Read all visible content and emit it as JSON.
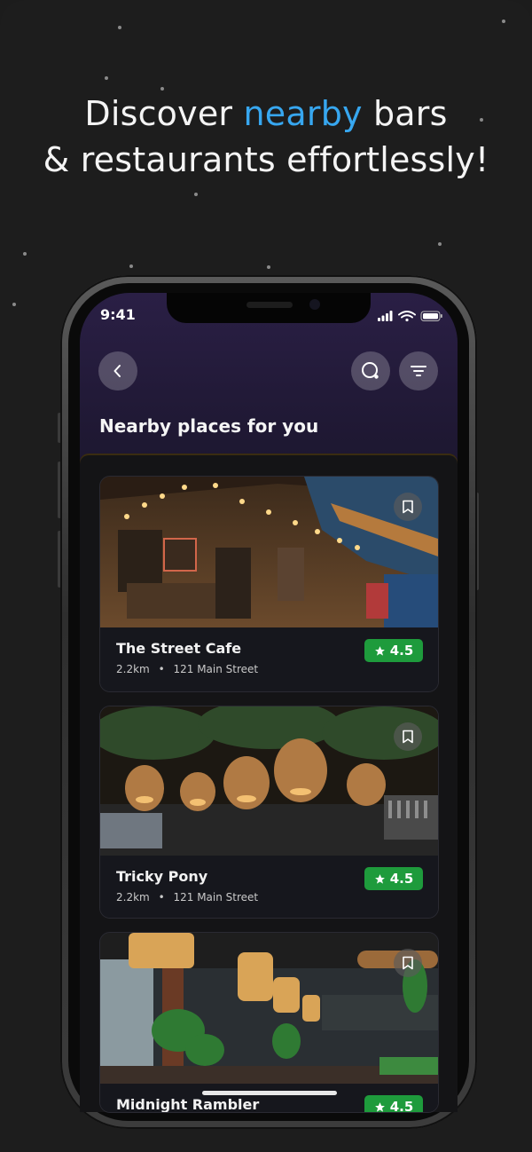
{
  "headline": {
    "line1_before": "Discover ",
    "line1_accent": "nearby",
    "line1_after": " bars",
    "line2": "& restaurants effortlessly!"
  },
  "colors": {
    "accent": "#37a7f0",
    "rating_badge": "#1e9b3c",
    "header_gradient_top": "#2a1f45"
  },
  "status_bar": {
    "time": "9:41",
    "icons": [
      "signal-icon",
      "wifi-icon",
      "battery-icon"
    ]
  },
  "header": {
    "back_icon": "chevron-left-icon",
    "search_icon": "search-icon",
    "filter_icon": "filter-icon",
    "title": "Nearby places for you"
  },
  "places": [
    {
      "name": "The Street Cafe",
      "distance": "2.2km",
      "separator": "•",
      "address": "121 Main Street",
      "rating": "4.5",
      "image": "cafe-interior-photo"
    },
    {
      "name": "Tricky Pony",
      "distance": "2.2km",
      "separator": "•",
      "address": "121 Main Street",
      "rating": "4.5",
      "image": "bar-interior-photo"
    },
    {
      "name": "Midnight Rambler",
      "distance": "",
      "separator": "",
      "address": "",
      "rating": "4.5",
      "image": "restaurant-interior-photo"
    }
  ]
}
